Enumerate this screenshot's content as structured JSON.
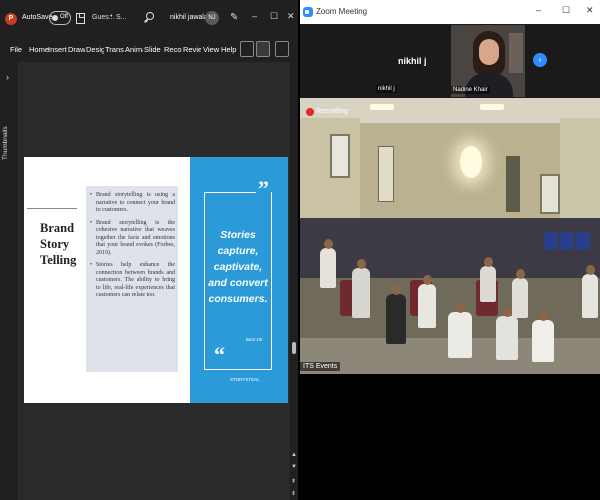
{
  "ppt": {
    "logo_letter": "P",
    "autosave_label": "AutoSave",
    "autosave_state": "Off",
    "doc_name": "Gues...",
    "doc_name2": "S...",
    "user_name": "nikhil jawala",
    "user_initials": "NJ",
    "window_controls": [
      "–",
      "☐",
      "✕"
    ],
    "ribbon_tabs": [
      "File",
      "Home",
      "Insert",
      "Draw",
      "Design",
      "Transitions",
      "Animations",
      "Slide Show",
      "Record",
      "Review",
      "View",
      "Help"
    ],
    "thumbnails_label": "Thumbnails",
    "slide": {
      "title": "Brand Story Telling",
      "bullets": [
        "Brand storytelling is using a narrative to connect your brand to customers.",
        "Brand storytelling is the cohesive narrative that weaves together the facts and emotions that your brand evokes (Forbes, 2019).",
        "Stories help enhance the connection between brands and customers. The ability to bring to life, real-life experiences that customers can relate too."
      ],
      "quote": "Stories capture, captivate, and convert consumers.",
      "quote_source": "Best 10!",
      "quote_credit": "STORYSTEAL",
      "quote_mark_top": "”",
      "quote_mark_bottom": "“"
    }
  },
  "zoom": {
    "title": "Zoom Meeting",
    "window_controls": [
      "–",
      "☐",
      "✕"
    ],
    "participants": [
      {
        "name_display": "nikhil j",
        "name_tag": "nikhil j"
      },
      {
        "name_tag": "Nadine Khair"
      }
    ],
    "next_arrow": "›",
    "recording_label": "Recording",
    "main_video_tag": "ITS Events"
  },
  "colors": {
    "ppt_accent": "#c43e1c",
    "zoom_accent": "#2d8cff",
    "quote_panel": "#2a9ad9",
    "recording_red": "#e02828"
  }
}
